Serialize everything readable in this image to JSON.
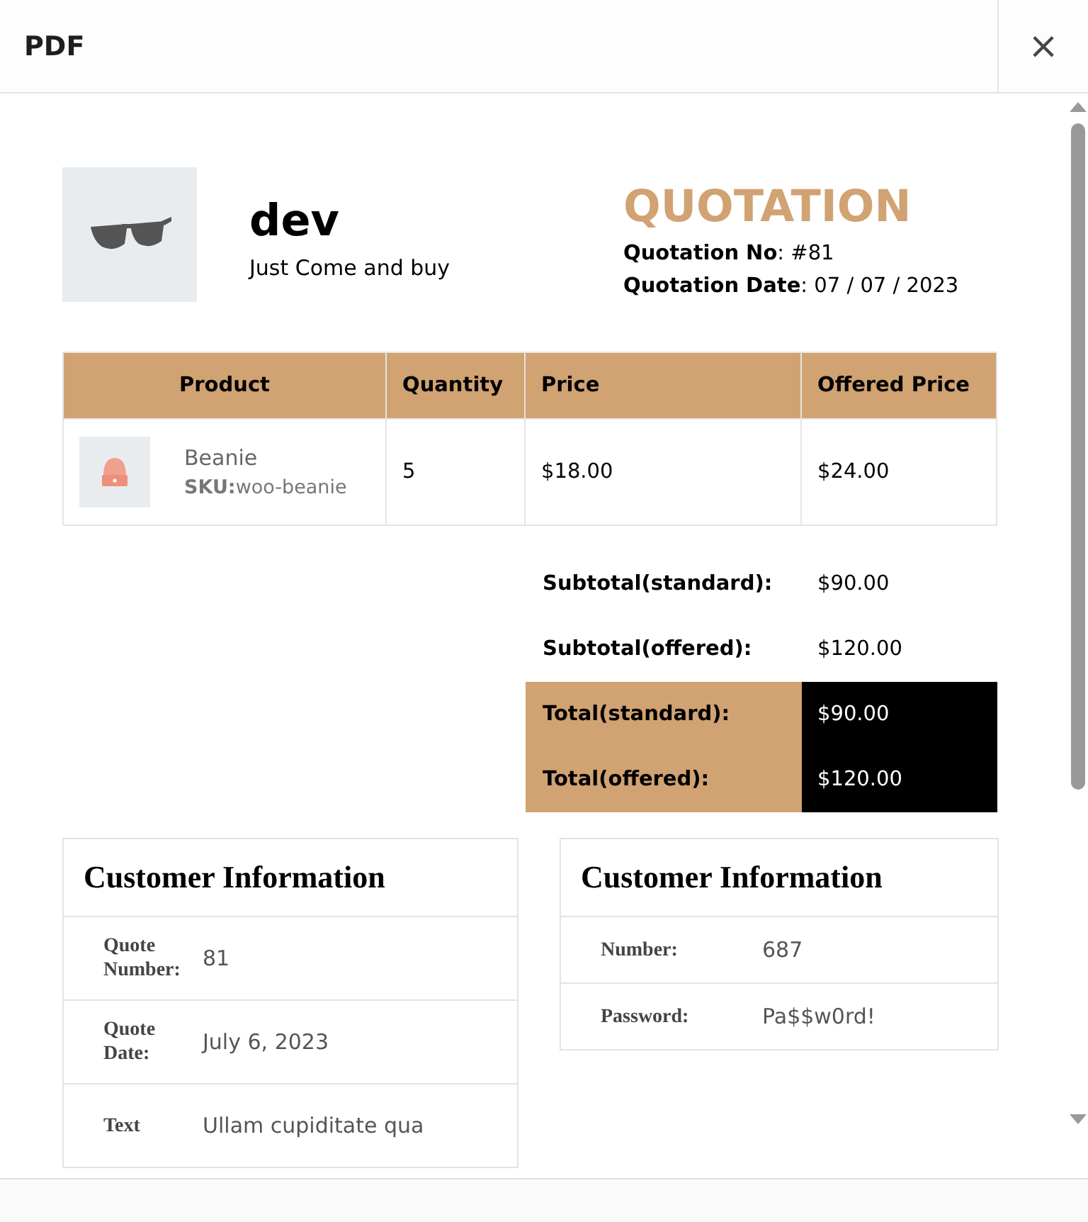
{
  "window": {
    "title": "PDF",
    "close": "×"
  },
  "header": {
    "store_name": "dev",
    "tagline": "Just Come and buy",
    "doc_title": "QUOTATION",
    "meta": [
      {
        "label": "Quotation No",
        "value": ": #81"
      },
      {
        "label": "Quotation Date",
        "value": ": 07 / 07 / 2023"
      }
    ]
  },
  "table": {
    "columns": [
      "Product",
      "Quantity",
      "Price",
      "Offered Price"
    ],
    "rows": [
      {
        "name": "Beanie",
        "sku_label": "SKU:",
        "sku": "woo-beanie",
        "quantity": "5",
        "price": "$18.00",
        "offered_price": "$24.00"
      }
    ]
  },
  "totals": [
    {
      "label": "Subtotal(standard):",
      "value": "$90.00",
      "highlight": false
    },
    {
      "label": "Subtotal(offered):",
      "value": "$120.00",
      "highlight": false
    },
    {
      "label": "Total(standard):",
      "value": "$90.00",
      "highlight": true
    },
    {
      "label": "Total(offered):",
      "value": "$120.00",
      "highlight": true
    }
  ],
  "info_cards": [
    {
      "title": "Customer Information",
      "rows": [
        {
          "label": "Quote Number:",
          "value": "81"
        },
        {
          "label": "Quote Date:",
          "value": "July 6, 2023"
        },
        {
          "label": "Text",
          "value": "Ullam cupiditate qua"
        }
      ]
    },
    {
      "title": "Customer Information",
      "rows": [
        {
          "label": "Number:",
          "value": "687"
        },
        {
          "label": "Password:",
          "value": "Pa$$w0rd!"
        }
      ]
    }
  ]
}
